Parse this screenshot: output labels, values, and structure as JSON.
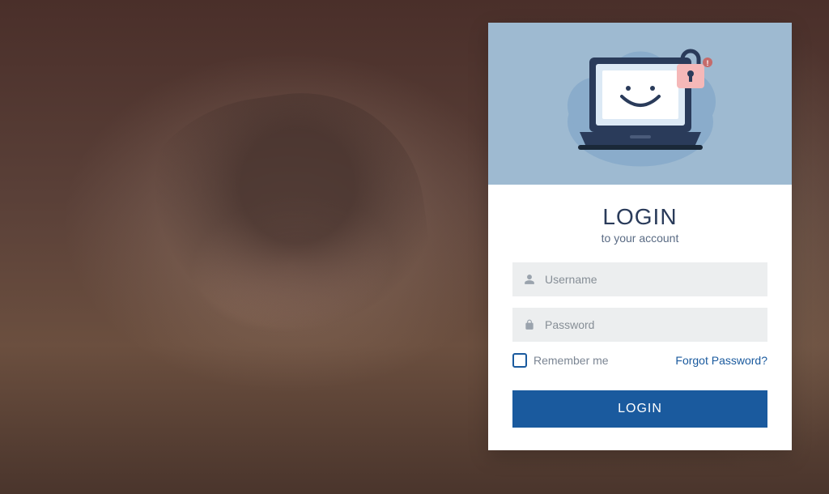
{
  "header": {
    "title": "LOGIN",
    "subtitle": "to your account"
  },
  "form": {
    "username": {
      "placeholder": "Username",
      "value": ""
    },
    "password": {
      "placeholder": "Password",
      "value": ""
    },
    "remember_label": "Remember me",
    "forgot_label": "Forgot Password?",
    "submit_label": "LOGIN"
  },
  "colors": {
    "accent": "#1a5a9e",
    "header_bg": "#9ebad1",
    "input_bg": "#eceeef"
  }
}
